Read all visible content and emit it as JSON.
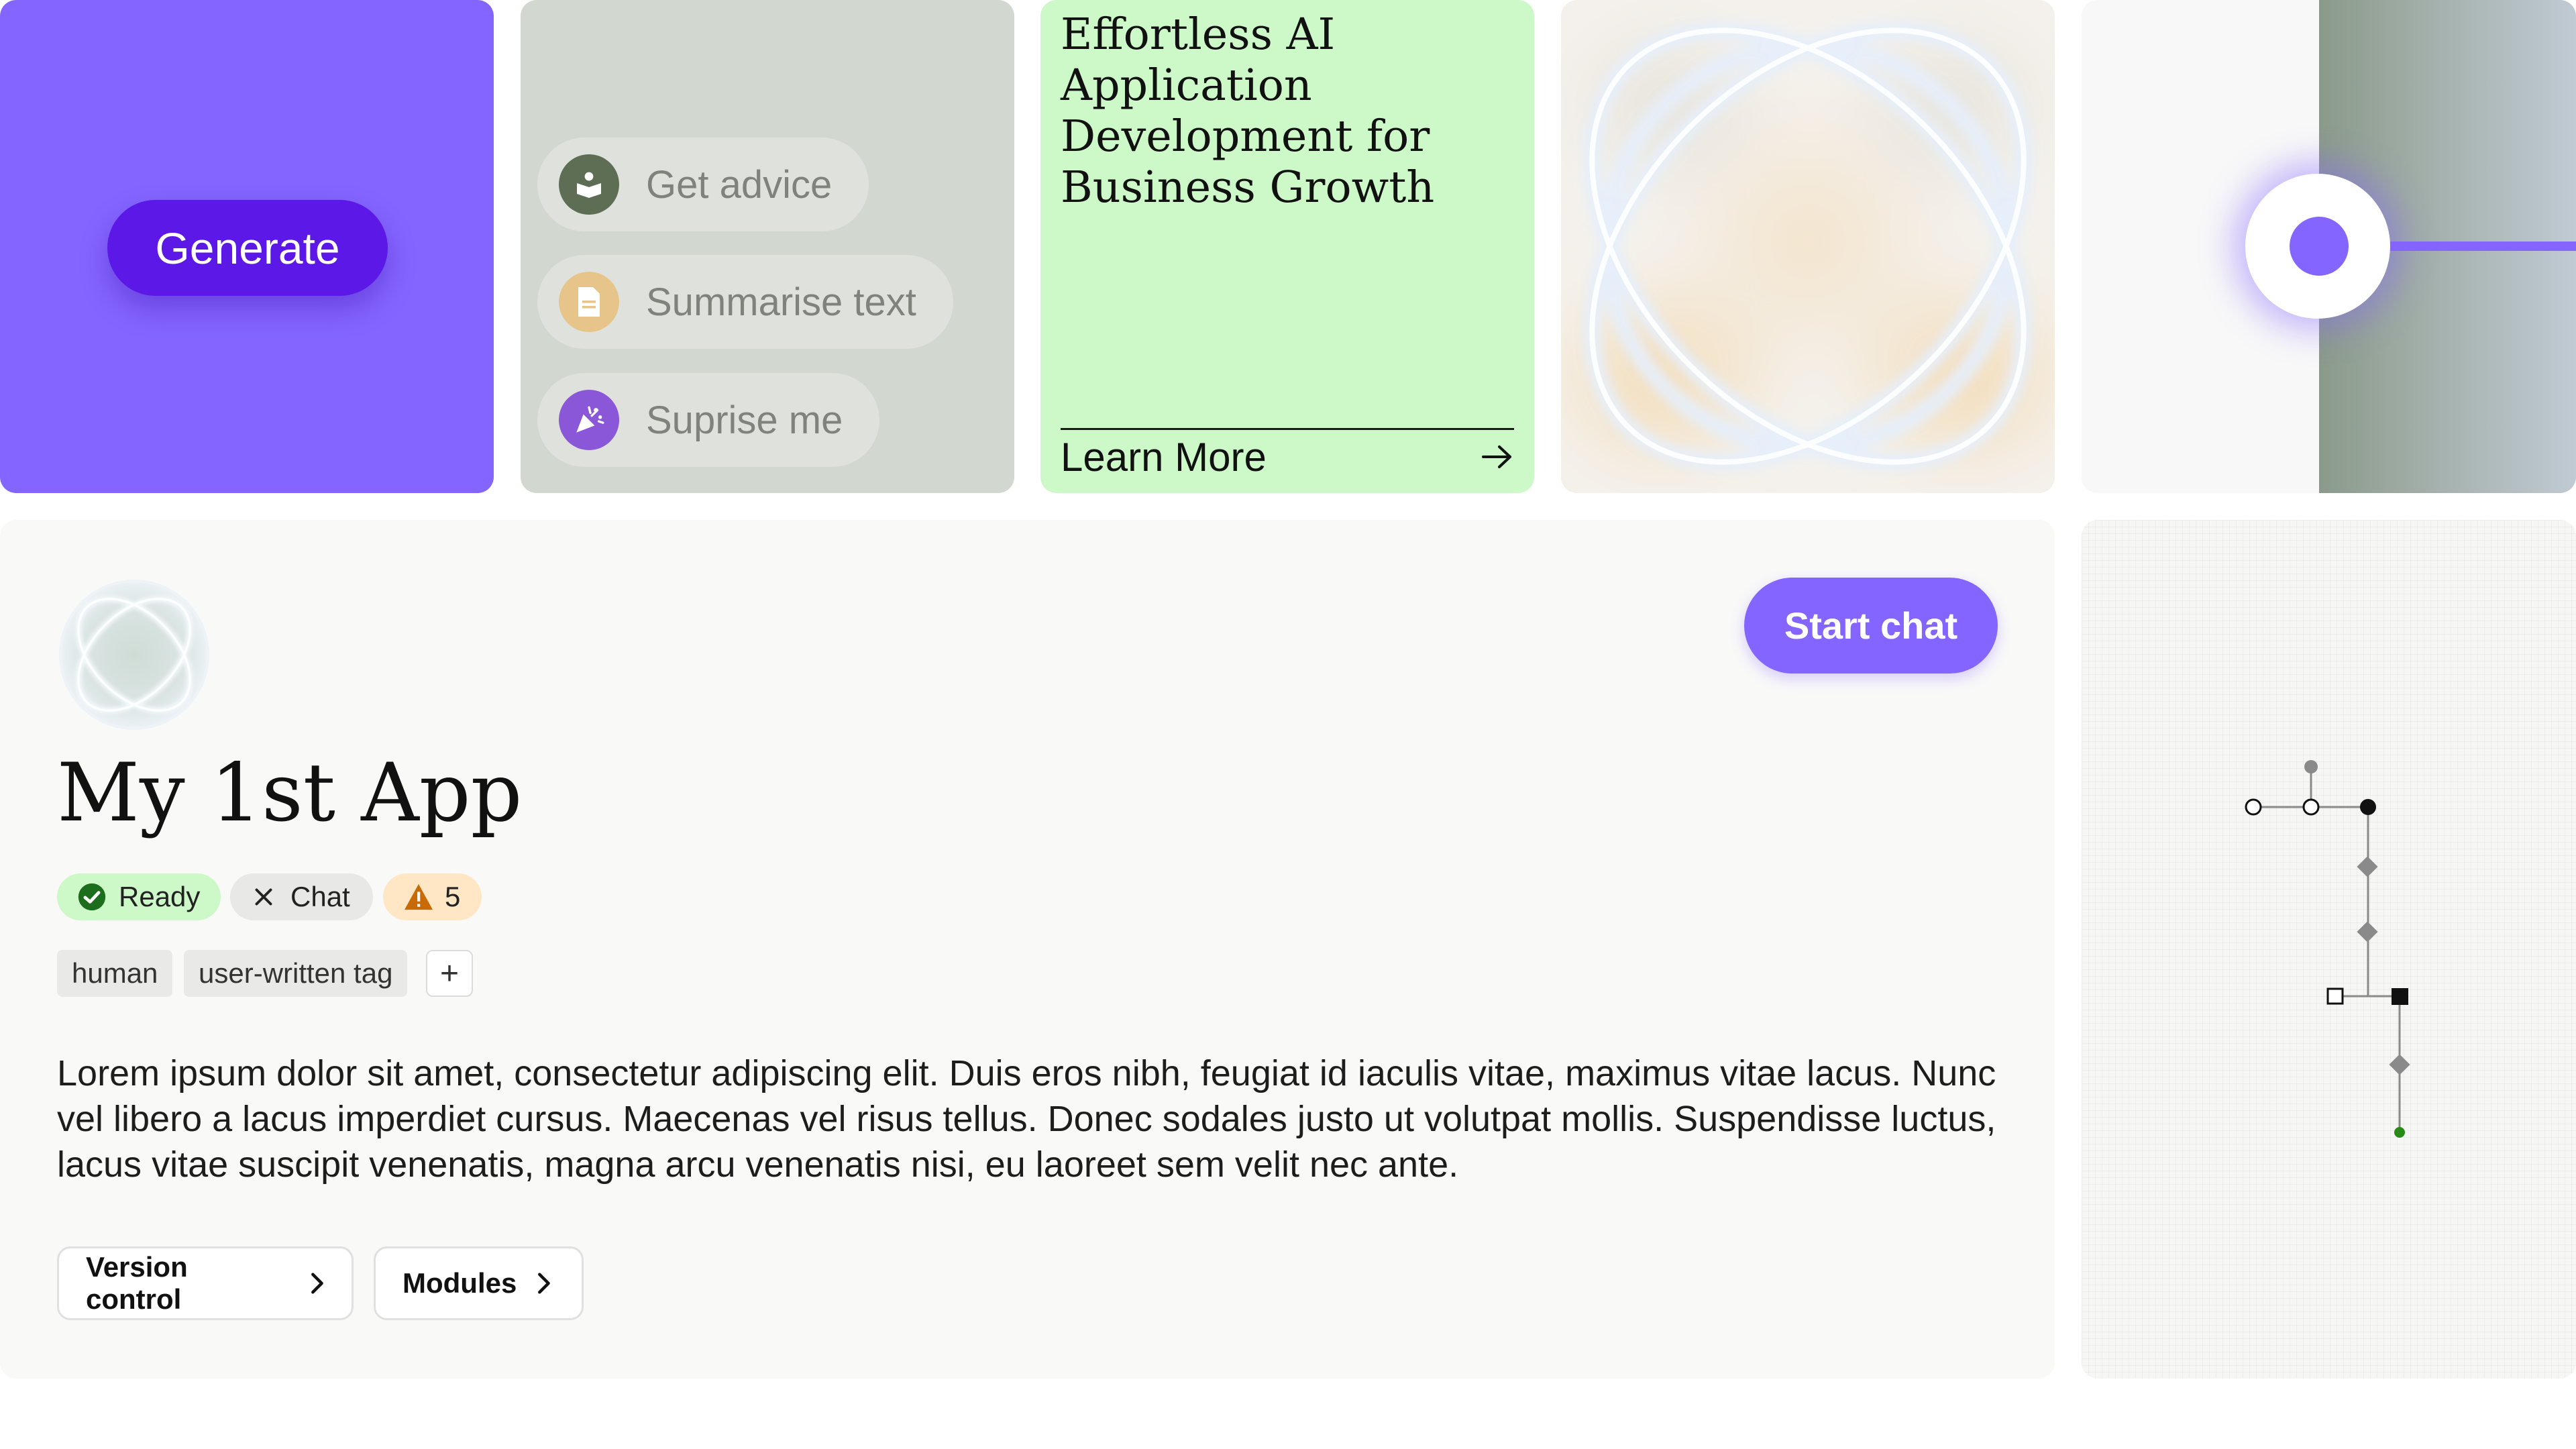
{
  "generate": {
    "label": "Generate"
  },
  "suggestions": {
    "items": [
      {
        "label": "Get advice",
        "icon": "book-reader-icon",
        "color": "#5d6e55"
      },
      {
        "label": "Summarise text",
        "icon": "document-icon",
        "color": "#e7c489"
      },
      {
        "label": "Suprise me",
        "icon": "party-popper-icon",
        "color": "#8b57d9"
      }
    ]
  },
  "article": {
    "title": "Effortless AI Application Development for Business Growth",
    "link_label": "Learn More"
  },
  "slider": {
    "accent": "#8465ff",
    "level": 0.3
  },
  "app": {
    "title": "My 1st App",
    "start_chat_label": "Start chat",
    "badges": {
      "ready": "Ready",
      "chat": "Chat",
      "warnings": "5"
    },
    "tags": [
      "human",
      "user-written tag"
    ],
    "add_tag_label": "+",
    "description": "Lorem ipsum dolor sit amet, consectetur adipiscing elit. Duis eros nibh, feugiat id iaculis vitae, maximus vitae lacus. Nunc vel libero a lacus imperdiet cursus. Maecenas vel risus tellus. Donec sodales justo ut volutpat mollis. Suspendisse luctus, lacus vitae suscipit venenatis, magna arcu venenatis nisi, eu laoreet sem velit nec ante.",
    "buttons": {
      "version_control": "Version control",
      "modules": "Modules"
    }
  },
  "colors": {
    "brand_purple": "#8465ff",
    "deep_purple": "#5b18e6",
    "ready_green": "#cdf8c8",
    "warning_orange": "#ffe6c4"
  }
}
